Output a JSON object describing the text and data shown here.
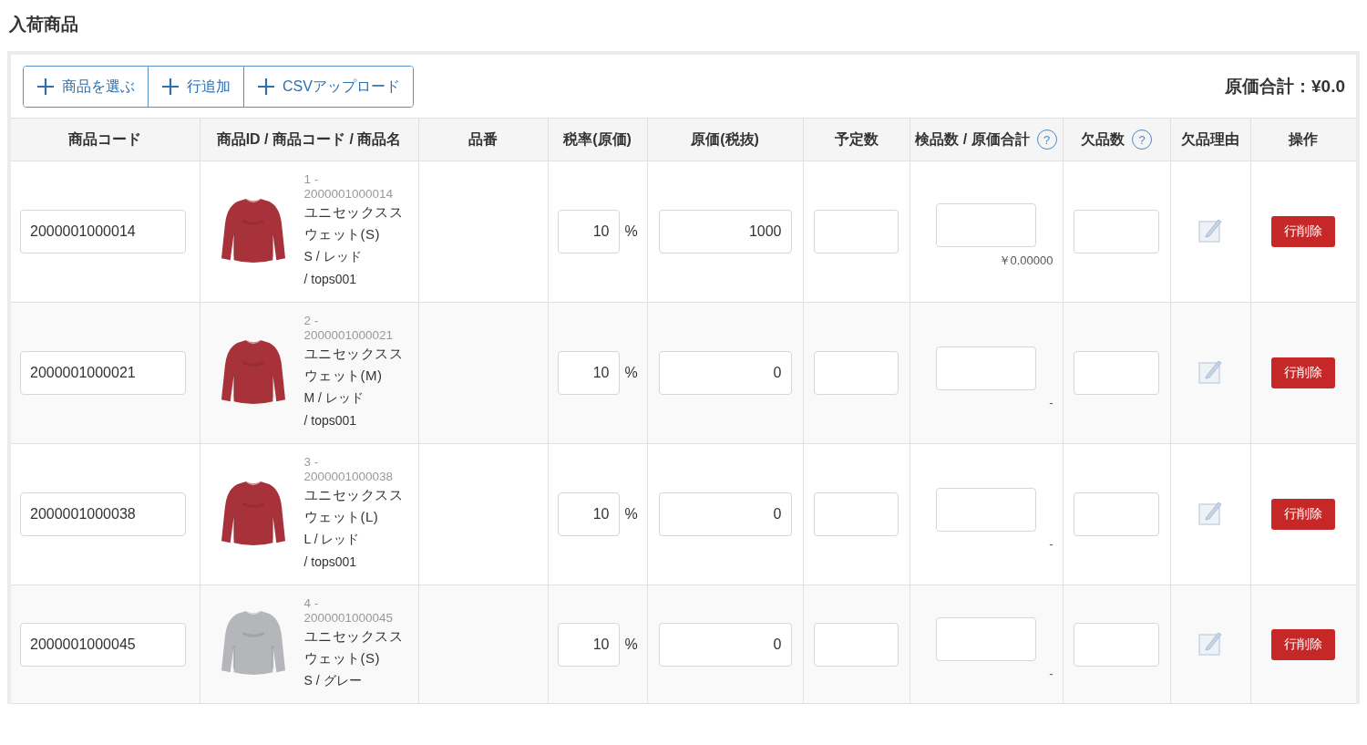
{
  "title": "入荷商品",
  "toolbar": {
    "buttons": [
      {
        "label": "商品を選ぶ"
      },
      {
        "label": "行追加"
      },
      {
        "label": "CSVアップロード"
      }
    ],
    "total": "原価合計：¥0.0"
  },
  "table": {
    "columns": [
      {
        "label": "商品コード"
      },
      {
        "label": "商品ID / 商品コード / 商品名"
      },
      {
        "label": "品番"
      },
      {
        "label": "税率(原価)"
      },
      {
        "label": "原価(税抜)"
      },
      {
        "label": "予定数"
      },
      {
        "label": "検品数 / 原価合計",
        "help": "?"
      },
      {
        "label": "欠品数",
        "help": "?"
      },
      {
        "label": "欠品理由"
      },
      {
        "label": "操作"
      }
    ],
    "rows": [
      {
        "code": "2000001000014",
        "id": "1 -",
        "item_code": "2000001000014",
        "name": "ユニセックススウェット(S)",
        "variant": "S / レッド",
        "sku": "/ tops001",
        "tax": "10",
        "tax_unit": "%",
        "cost": "1000",
        "subtotal": "￥0.00000",
        "delete": "行削除"
      },
      {
        "code": "2000001000021",
        "id": "2 -",
        "item_code": "2000001000021",
        "name": "ユニセックススウェット(M)",
        "variant": "M / レッド",
        "sku": "/ tops001",
        "tax": "10",
        "tax_unit": "%",
        "cost": "0",
        "subtotal": "-",
        "delete": "行削除"
      },
      {
        "code": "2000001000038",
        "id": "3 -",
        "item_code": "2000001000038",
        "name": "ユニセックススウェット(L)",
        "variant": "L / レッド",
        "sku": "/ tops001",
        "tax": "10",
        "tax_unit": "%",
        "cost": "0",
        "subtotal": "-",
        "delete": "行削除"
      },
      {
        "code": "2000001000045",
        "id": "4 -",
        "item_code": "2000001000045",
        "name": "ユニセックススウェット(S)",
        "variant": "S / グレー",
        "sku": "",
        "tax": "10",
        "tax_unit": "%",
        "cost": "0",
        "subtotal": "-",
        "delete": "行削除"
      }
    ]
  }
}
